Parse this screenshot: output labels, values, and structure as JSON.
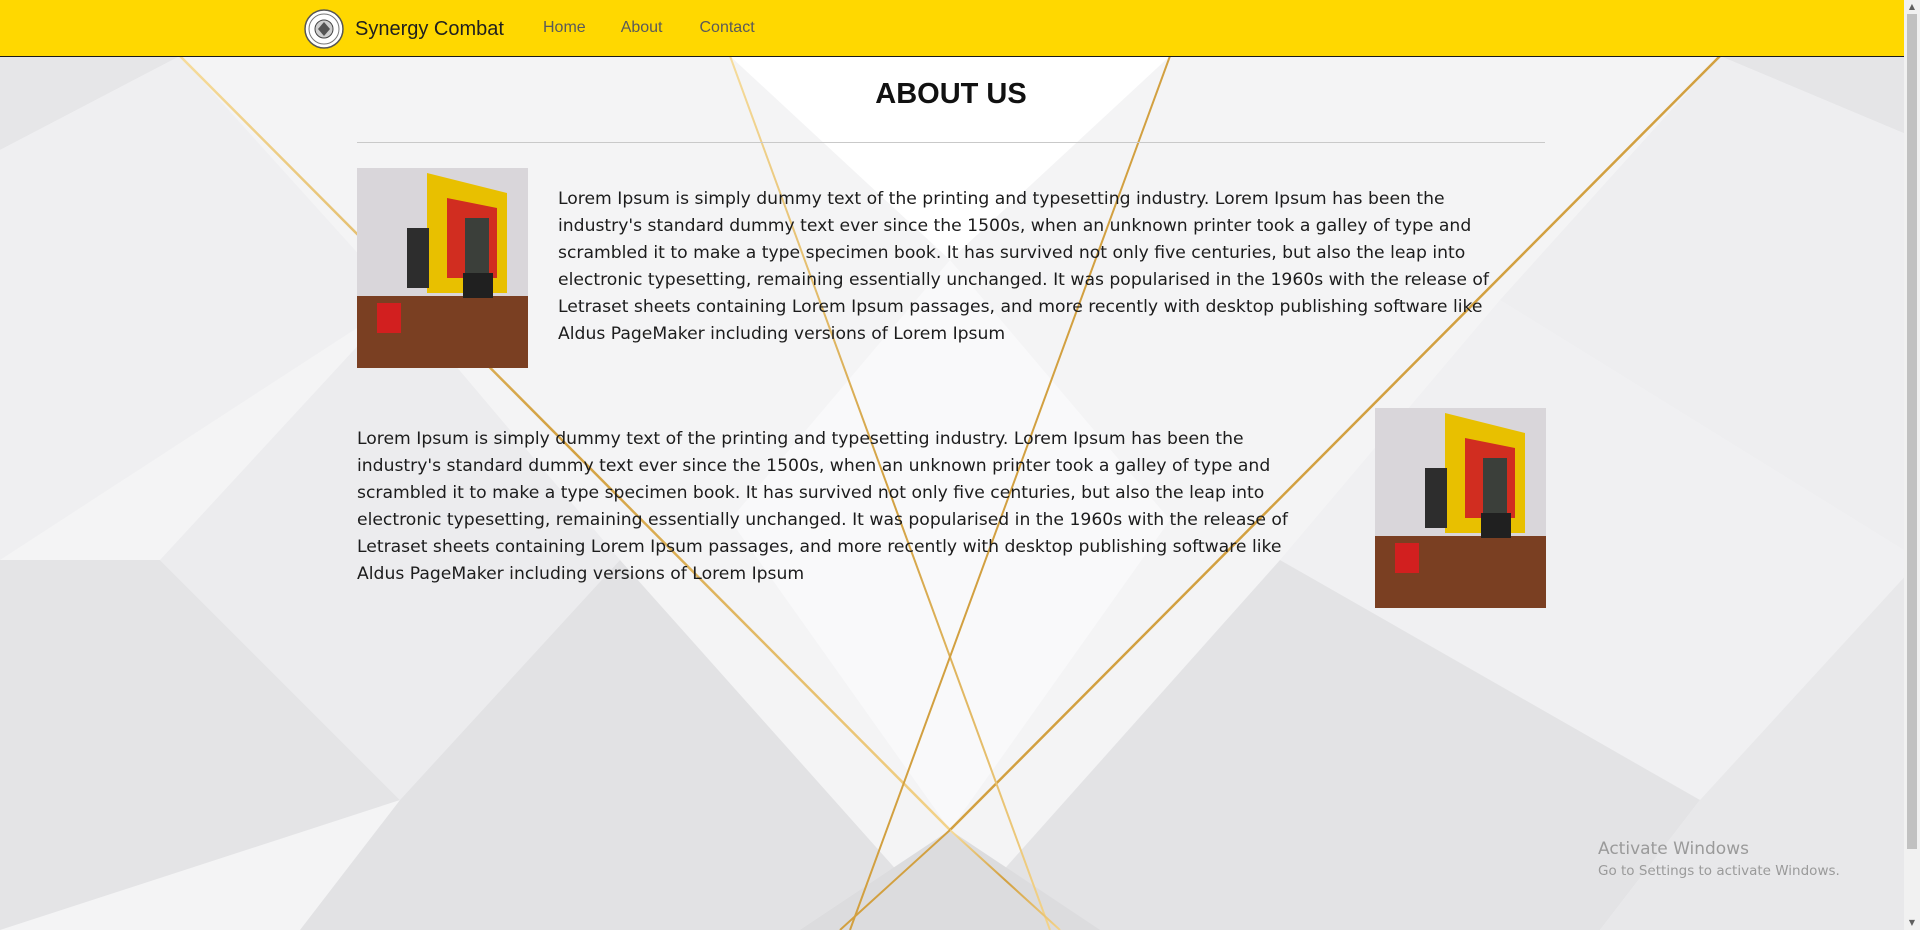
{
  "navbar": {
    "brand": "Synergy Combat",
    "links": [
      "Home",
      "About",
      "Contact"
    ]
  },
  "about": {
    "title": "ABOUT US",
    "paragraph_1": "Lorem Ipsum is simply dummy text of the printing and typesetting industry. Lorem Ipsum has been the industry's standard dummy text ever since the 1500s, when an unknown printer took a galley of type and scrambled it to make a type specimen book. It has survived not only five centuries, but also the leap into electronic typesetting, remaining essentially unchanged. It was popularised in the 1960s with the release of Letraset sheets containing Lorem Ipsum passages, and more recently with desktop publishing software like Aldus PageMaker including versions of Lorem Ipsum",
    "paragraph_2": "Lorem Ipsum is simply dummy text of the printing and typesetting industry. Lorem Ipsum has been the industry's standard dummy text ever since the 1500s, when an unknown printer took a galley of type and scrambled it to make a type specimen book. It has survived not only five centuries, but also the leap into electronic typesetting, remaining essentially unchanged. It was popularised in the 1960s with the release of Letraset sheets containing Lorem Ipsum passages, and more recently with desktop publishing software like Aldus PageMaker including versions of Lorem Ipsum"
  },
  "watermark": {
    "title": "Activate Windows",
    "subtitle": "Go to Settings to activate Windows."
  },
  "colors": {
    "navbar": "#ffd800",
    "accent_gold": "#d8a84a",
    "background": "#f3f3f4"
  }
}
